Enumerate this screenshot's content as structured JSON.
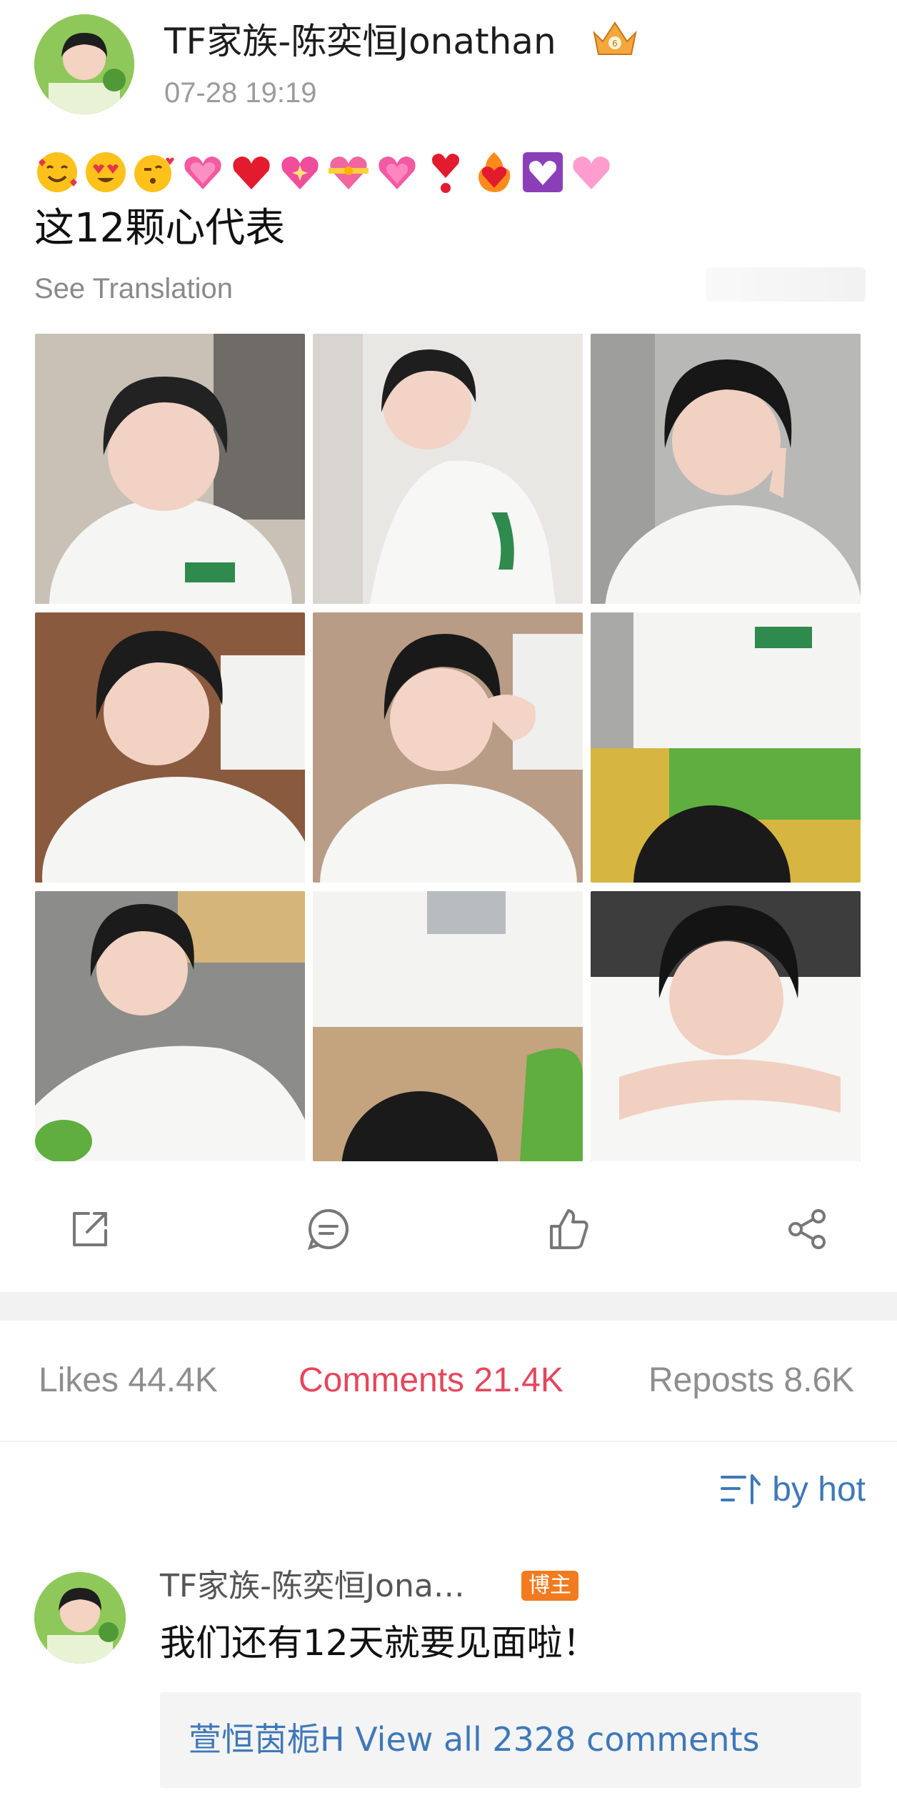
{
  "post": {
    "author_name": "TF家族-陈奕恒Jonathan",
    "timestamp": "07-28 19:19",
    "emojis": [
      "smiling-face-with-hearts",
      "heart-eyes-face",
      "kissing-face-with-heart",
      "growing-heart",
      "red-heart",
      "sparkling-heart",
      "heart-with-ribbon",
      "two-hearts",
      "heart-exclamation",
      "heart-on-fire",
      "white-heart-box",
      "pink-heart"
    ],
    "text": "这12颗心代表",
    "translate_label": "See Translation",
    "photo_count": 9
  },
  "actions": {
    "repost_icon": "share-out-icon",
    "comment_icon": "comment-bubble-icon",
    "like_icon": "thumbs-up-icon",
    "share_icon": "share-nodes-icon"
  },
  "stats": {
    "likes_label": "Likes 44.4K",
    "comments_label": "Comments 21.4K",
    "reposts_label": "Reposts 8.6K",
    "active_tab": "comments"
  },
  "sort": {
    "label": "by hot"
  },
  "comment": {
    "author": "TF家族-陈奕恒Jona…",
    "badge": "博主",
    "text": "我们还有12天就要见面啦！",
    "replies_label": "萱恒茵栀H View all 2328 comments"
  },
  "colors": {
    "accent_active": "#e5465b",
    "link_blue": "#3f78b8",
    "badge_orange": "#f27a1f",
    "muted_text": "#8e8e8e"
  }
}
